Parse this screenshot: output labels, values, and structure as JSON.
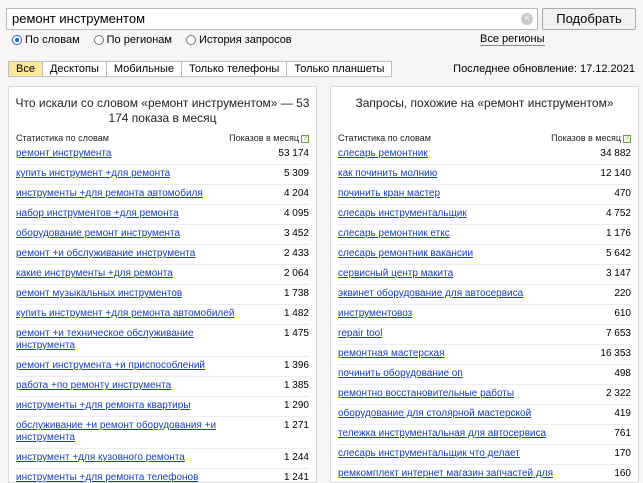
{
  "search": {
    "value": "ремонт инструментом",
    "clear_glyph": "×",
    "submit_label": "Подобрать",
    "options": [
      "По словам",
      "По регионам",
      "История запросов"
    ],
    "selected_index": 0,
    "regions_link": "Все регионы"
  },
  "tabs": [
    "Все",
    "Десктопы",
    "Мобильные",
    "Только телефоны",
    "Только планшеты"
  ],
  "active_tab": 0,
  "last_update": "Последнее обновление: 17.12.2021",
  "left_panel": {
    "title": "Что искали со словом «ремонт инструментом» — 53 174 показа в месяц",
    "col_phrase": "Статистика по словам",
    "col_count": "Показов в месяц",
    "help_glyph": "?",
    "rows": [
      {
        "phrase": "ремонт инструмента",
        "count": "53 174"
      },
      {
        "phrase": "купить инструмент +для ремонта",
        "count": "5 309"
      },
      {
        "phrase": "инструменты +для ремонта автомобиля",
        "count": "4 204"
      },
      {
        "phrase": "набор инструментов +для ремонта",
        "count": "4 095"
      },
      {
        "phrase": "оборудование ремонт инструмента",
        "count": "3 452"
      },
      {
        "phrase": "ремонт +и обслуживание инструмента",
        "count": "2 433"
      },
      {
        "phrase": "какие инструменты +для ремонта",
        "count": "2 064"
      },
      {
        "phrase": "ремонт музыкальных инструментов",
        "count": "1 738"
      },
      {
        "phrase": "купить инструмент +для ремонта автомобилей",
        "count": "1 482"
      },
      {
        "phrase": "ремонт +и техническое обслуживание инструмента",
        "count": "1 475"
      },
      {
        "phrase": "ремонт инструмента +и приспособлений",
        "count": "1 396"
      },
      {
        "phrase": "работа +по ремонту инструмента",
        "count": "1 385"
      },
      {
        "phrase": "инструменты +для ремонта квартиры",
        "count": "1 290"
      },
      {
        "phrase": "обслуживание +и ремонт оборудования +и инструмента",
        "count": "1 271"
      },
      {
        "phrase": "инструмент +для кузовного ремонта",
        "count": "1 244"
      },
      {
        "phrase": "инструменты +для ремонта телефонов",
        "count": "1 241"
      }
    ]
  },
  "right_panel": {
    "title": "Запросы, похожие на «ремонт инструментом»",
    "col_phrase": "Статистика по словам",
    "col_count": "Показов в месяц",
    "help_glyph": "?",
    "rows": [
      {
        "phrase": "слесарь ремонтник",
        "count": "34 882"
      },
      {
        "phrase": "как починить молнию",
        "count": "12 140"
      },
      {
        "phrase": "починить кран мастер",
        "count": "470"
      },
      {
        "phrase": "слесарь инструментальщик",
        "count": "4 752"
      },
      {
        "phrase": "слесарь ремонтник еткс",
        "count": "1 176"
      },
      {
        "phrase": "слесарь ремонтник вакансии",
        "count": "5 642"
      },
      {
        "phrase": "сервисный центр макита",
        "count": "3 147"
      },
      {
        "phrase": "эквинет оборудование для автосервиса",
        "count": "220"
      },
      {
        "phrase": "инструментовоз",
        "count": "610"
      },
      {
        "phrase": "repair tool",
        "count": "7 653"
      },
      {
        "phrase": "ремонтная мастерская",
        "count": "16 353"
      },
      {
        "phrase": "починить оборудование оп",
        "count": "498"
      },
      {
        "phrase": "ремонтно восстановительные работы",
        "count": "2 322"
      },
      {
        "phrase": "оборудование для столярной мастерской",
        "count": "419"
      },
      {
        "phrase": "тележка инструментальная для автосервиса",
        "count": "761"
      },
      {
        "phrase": "слесарь инструментальщик что делает",
        "count": "170"
      },
      {
        "phrase": "ремкомплект интернет магазин запчастей для электроинструмента",
        "count": "160"
      }
    ]
  }
}
